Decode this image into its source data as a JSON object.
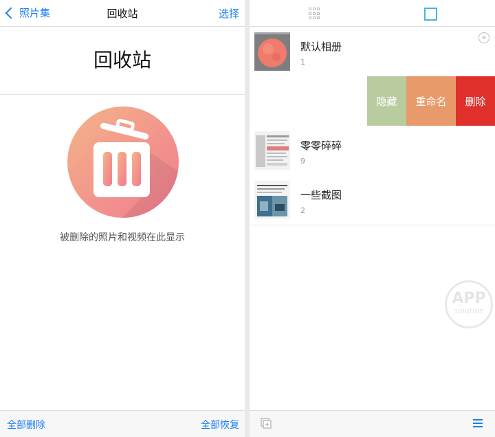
{
  "left": {
    "nav": {
      "back_label": "照片集",
      "title": "回收站",
      "select_label": "选择"
    },
    "big_title": "回收站",
    "message": "被删除的照片和视频在此显示",
    "footer": {
      "delete_all": "全部删除",
      "restore_all": "全部恢复"
    }
  },
  "right": {
    "albums": [
      {
        "name": "默认相册",
        "count": "1"
      },
      {
        "name": "零零碎碎",
        "count": "9"
      },
      {
        "name": "一些截图",
        "count": "2"
      }
    ],
    "swipe_actions": {
      "hide": "隐藏",
      "rename": "重命名",
      "delete": "删除"
    },
    "watermark": {
      "line1": "APP",
      "line2": "solution"
    }
  },
  "colors": {
    "accent": "#1a7ef3",
    "hide": "#b9cc9f",
    "rename": "#e99a6a",
    "delete": "#e0302c",
    "active_view": "#43b4e6"
  },
  "icons": [
    "chevron-left-icon",
    "trash-icon",
    "grid-view-icon",
    "single-view-icon",
    "infinity-icon",
    "add-album-icon",
    "list-icon"
  ]
}
